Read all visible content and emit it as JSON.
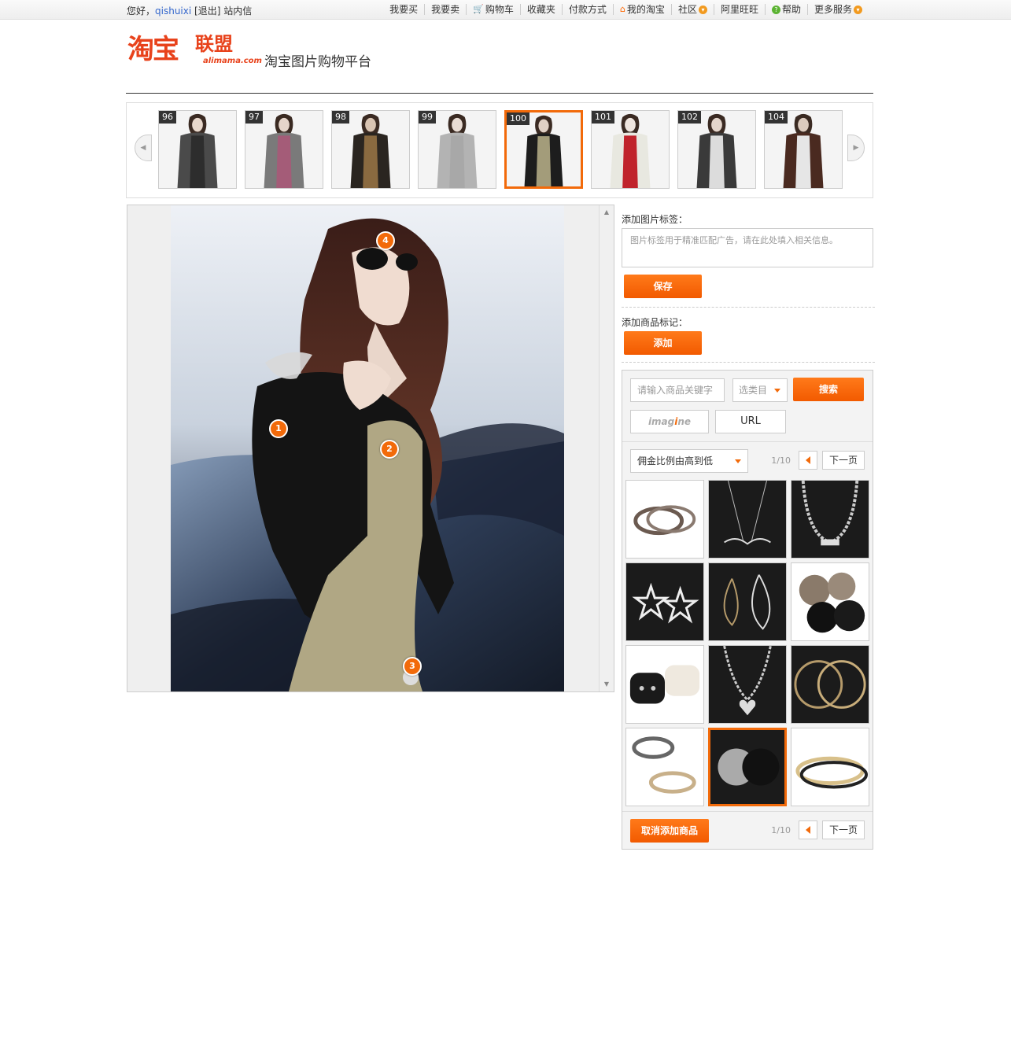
{
  "topbar": {
    "greeting": "您好，",
    "username": "qishuixi",
    "logout": "[退出]",
    "inbox": "站内信",
    "links": [
      {
        "label": "我要买",
        "icon": ""
      },
      {
        "label": "我要卖",
        "icon": ""
      },
      {
        "label": "购物车",
        "icon": "cart-icon"
      },
      {
        "label": "收藏夹",
        "icon": ""
      },
      {
        "label": "付款方式",
        "icon": ""
      },
      {
        "label": "我的淘宝",
        "icon": "home-icon"
      },
      {
        "label": "社区",
        "icon": "dropdown-icon"
      },
      {
        "label": "阿里旺旺",
        "icon": ""
      },
      {
        "label": "帮助",
        "icon": "help-icon"
      },
      {
        "label": "更多服务",
        "icon": "dropdown-icon"
      }
    ]
  },
  "header": {
    "logo_main": "淘宝",
    "logo_sub": "联盟",
    "logo_domain": "alimama.com",
    "slogan": "淘宝图片购物平台"
  },
  "strip": {
    "thumbs": [
      {
        "num": "96",
        "selected": false,
        "coat": "#4a4a4a",
        "top": "#2d2d2d",
        "skin": "#e8d8cc"
      },
      {
        "num": "97",
        "selected": false,
        "coat": "#7a7a7a",
        "top": "#a45c78",
        "skin": "#e5d5ca"
      },
      {
        "num": "98",
        "selected": false,
        "coat": "#2a2520",
        "top": "#8a6a40",
        "skin": "#d9c4b2"
      },
      {
        "num": "99",
        "selected": false,
        "coat": "#b3b3b3",
        "top": "#a8a8a8",
        "skin": "#e8dcd4"
      },
      {
        "num": "100",
        "selected": true,
        "coat": "#1d1d1d",
        "top": "#a39c7a",
        "skin": "#e0d0c5"
      },
      {
        "num": "101",
        "selected": false,
        "coat": "#e8e8e0",
        "top": "#c0232b",
        "skin": "#efe5de"
      },
      {
        "num": "102",
        "selected": false,
        "coat": "#3a3a3a",
        "top": "#dcdcdc",
        "skin": "#e3d5cb"
      },
      {
        "num": "104",
        "selected": false,
        "coat": "#4a2a20",
        "top": "#e6e6e6",
        "skin": "#dccbbe"
      }
    ]
  },
  "photo": {
    "markers": [
      "1",
      "2",
      "3",
      "4"
    ]
  },
  "right": {
    "tag_label": "添加图片标签：",
    "tag_placeholder": "图片标签用于精准匹配广告，请在此处填入相关信息。",
    "save": "保存",
    "item_label": "添加商品标记：",
    "add": "添加",
    "search_placeholder": "请输入商品关键字",
    "category": "选类目",
    "search": "搜索",
    "tab_imagine": "imagine",
    "tab_url": "URL",
    "sort": "佣金比例由高到低",
    "page": "1/10",
    "next": "下一页",
    "cancel": "取消添加商品",
    "products": [
      {
        "name": "bracelet-rings",
        "dark": false,
        "selected": false
      },
      {
        "name": "chain-necklace-wings",
        "dark": true,
        "selected": false
      },
      {
        "name": "silver-chain-necklace",
        "dark": true,
        "selected": false
      },
      {
        "name": "star-earrings",
        "dark": true,
        "selected": false
      },
      {
        "name": "drop-chain-earrings",
        "dark": true,
        "selected": false
      },
      {
        "name": "studded-ball-earrings",
        "dark": false,
        "selected": false
      },
      {
        "name": "studded-cuffs",
        "dark": false,
        "selected": false
      },
      {
        "name": "heart-necklace",
        "dark": true,
        "selected": false
      },
      {
        "name": "hoop-earrings",
        "dark": true,
        "selected": false
      },
      {
        "name": "layered-rings",
        "dark": false,
        "selected": false
      },
      {
        "name": "bead-ball-earrings",
        "dark": true,
        "selected": true
      },
      {
        "name": "stacked-bangles",
        "dark": false,
        "selected": false
      }
    ]
  },
  "colors": {
    "accent": "#f26a0a",
    "brand": "#e8421b",
    "link": "#3366cc"
  }
}
